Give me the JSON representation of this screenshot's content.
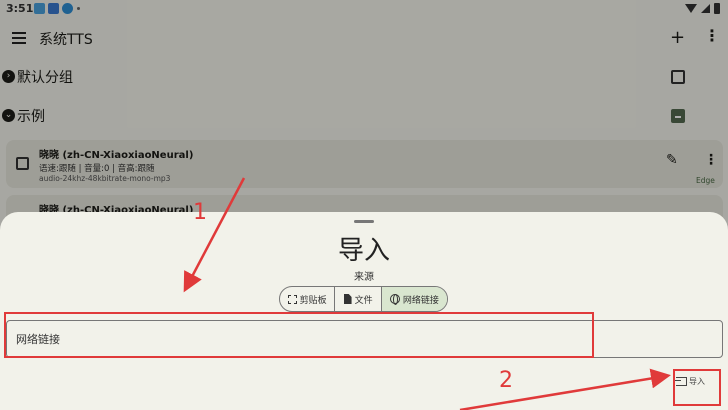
{
  "status_bar": {
    "time": "3:51"
  },
  "app_bar": {
    "title": "系统TTS",
    "add_icon": "plus-icon",
    "more_icon": "more-vert-icon"
  },
  "groups": [
    {
      "title": "默认分组"
    },
    {
      "title": "示例"
    }
  ],
  "items": [
    {
      "name": "晓晓 (zh-CN-XiaoxiaoNeural)",
      "info": "语速:跟随 | 音量:0 | 音高:跟随",
      "format": "audio-24khz-48kbitrate-mono-mp3",
      "badge": "Edge"
    },
    {
      "name": "晓晓 (zh-CN-XiaoxiaoNeural)"
    }
  ],
  "sheet": {
    "title": "导入",
    "source_label": "来源",
    "segments": [
      {
        "label": "剪贴板",
        "icon": "clipboard-icon"
      },
      {
        "label": "文件",
        "icon": "file-icon"
      },
      {
        "label": "网络链接",
        "icon": "globe-icon",
        "selected": true
      }
    ],
    "url_input": {
      "placeholder": "网络链接",
      "value": ""
    },
    "import_button": {
      "label": "导入",
      "icon": "import-icon"
    }
  },
  "annotations": {
    "step1": "1",
    "step2": "2",
    "color": "#e03a3a"
  }
}
